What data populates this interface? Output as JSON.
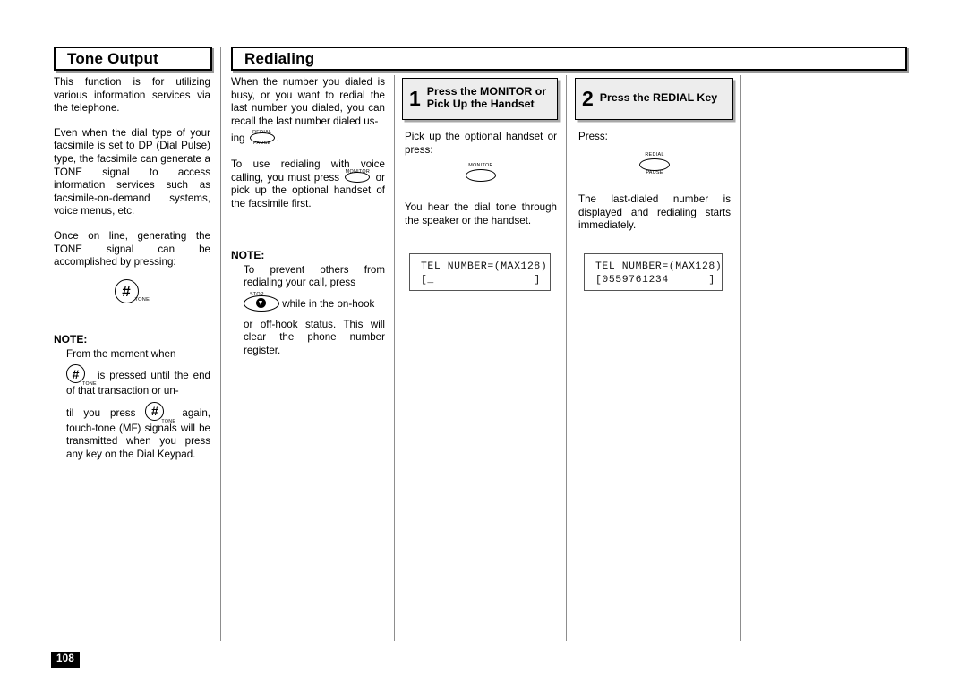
{
  "page": {
    "number": "108"
  },
  "sections": {
    "tone_output": {
      "title": "Tone Output",
      "paragraphs": [
        "This function is for utilizing various information services via the telephone.",
        "Even when the dial type of your facsimile is set to DP (Dial Pulse) type, the facsimile can generate a TONE signal to access information services such as facsimile-on-demand systems, voice menus, etc.",
        "Once on line, generating the TONE signal can be accomplished by pressing:"
      ],
      "note_label": "NOTE:",
      "note_text_1": "From the moment when",
      "note_text_2": "is pressed until the end of that transaction or un-",
      "note_text_3": "til you press",
      "note_text_4": "again, touch-tone (MF) signals will be transmitted when you press any key on the Dial Keypad."
    },
    "redialing": {
      "title": "Redialing",
      "intro_text_1": "When the number you dialed is busy, or you want to redial the last number you dialed, you can recall the last number dialed us-",
      "intro_text_2": "ing",
      "intro_text_3": ".",
      "voice_text_1": "To use redialing with voice calling, you must press",
      "voice_text_2": "or pick up the optional handset of the facsimile first.",
      "note_label": "NOTE:",
      "note_text_1": "To prevent others from redialing your call, press",
      "note_text_2": "while in the on-hook",
      "note_text_3": "or off-hook status. This will clear the phone number register."
    }
  },
  "steps": [
    {
      "number": "1",
      "label": "Press the MONITOR or Pick Up the Handset",
      "body_1": "Pick up the optional handset or press:",
      "body_2": "You hear the dial tone through the speaker or the handset.",
      "lcd_line_1": "TEL NUMBER=(MAX128)",
      "lcd_line_2": "[_               ]"
    },
    {
      "number": "2",
      "label": "Press the REDIAL Key",
      "body_1": "Press:",
      "body_2": "The last-dialed number is displayed and redialing starts immediately.",
      "lcd_line_1": "TEL NUMBER=(MAX128)",
      "lcd_line_2": "[0559761234      ]"
    }
  ],
  "keys": {
    "tone": {
      "glyph": "#",
      "sub": "TONE"
    },
    "redial": {
      "cap": "REDIAL",
      "foot": "PAUSE"
    },
    "monitor": {
      "cap": "MONITOR"
    },
    "stop": {
      "cap": "STOP"
    }
  },
  "colors": {
    "ink": "#000000",
    "step_fill": "#ededed",
    "rule": "#8d8d8d",
    "shadow": "#a8a8a8"
  }
}
